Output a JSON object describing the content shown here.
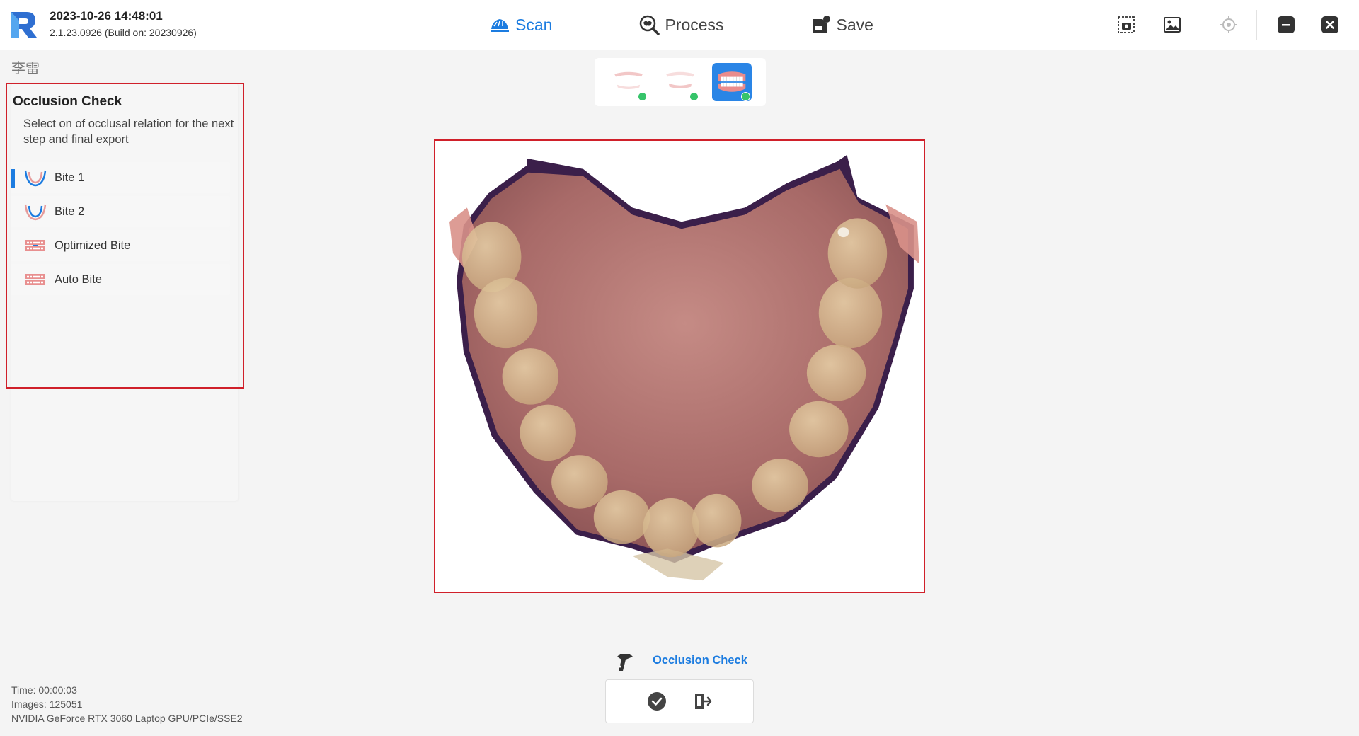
{
  "header": {
    "datetime": "2023-10-26 14:48:01",
    "version": "2.1.23.0926 (Build on: 20230926)",
    "workflow": [
      {
        "label": "Scan",
        "icon": "scan-icon",
        "active": true
      },
      {
        "label": "Process",
        "icon": "process-icon",
        "active": false
      },
      {
        "label": "Save",
        "icon": "save-icon",
        "active": false
      }
    ],
    "right_icons": [
      "screenshot-icon",
      "gallery-icon",
      "locate-icon",
      "minimize-icon",
      "close-icon"
    ]
  },
  "patient": {
    "name": "李雷"
  },
  "panel": {
    "title": "Occlusion Check",
    "description": "Select on of occlusal relation for the next step and final export",
    "items": [
      {
        "label": "Bite 1",
        "selected": true
      },
      {
        "label": "Bite 2",
        "selected": false
      },
      {
        "label": "Optimized Bite",
        "selected": false
      },
      {
        "label": "Auto Bite",
        "selected": false
      }
    ]
  },
  "thumbnails": [
    {
      "name": "upper-jaw",
      "checked": true,
      "active": false
    },
    {
      "name": "lower-jaw",
      "checked": true,
      "active": false
    },
    {
      "name": "bite",
      "checked": true,
      "active": true
    }
  ],
  "bottom": {
    "step_label": "Occlusion Check",
    "actions": [
      "confirm-icon",
      "exit-icon"
    ]
  },
  "info": {
    "time": "Time: 00:00:03",
    "images": "Images: 125051",
    "gpu": "NVIDIA GeForce RTX 3060 Laptop GPU/PCIe/SSE2"
  },
  "colors": {
    "accent": "#1c7ce0",
    "highlight_border": "#d0202a",
    "check_green": "#36c46a"
  }
}
